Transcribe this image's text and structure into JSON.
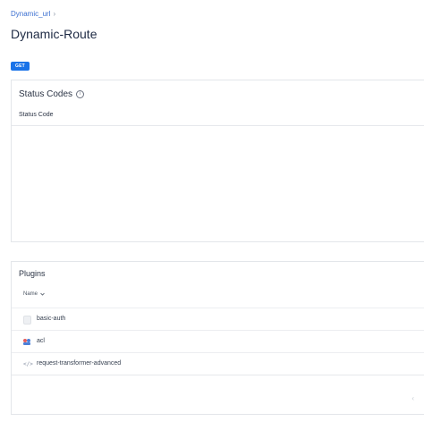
{
  "breadcrumb": {
    "parent": "Dynamic_url",
    "separator": "›"
  },
  "page": {
    "title": "Dynamic-Route",
    "method": "GET"
  },
  "status_codes": {
    "title": "Status Codes",
    "info_icon": "info-icon",
    "column_header": "Status Code"
  },
  "plugins": {
    "title": "Plugins",
    "name_header": "Name",
    "sort_icon": "chevron-down-icon",
    "items": [
      {
        "label": "basic-auth",
        "icon": "document-icon"
      },
      {
        "label": "acl",
        "icon": "users-icon"
      },
      {
        "label": "request-transformer-advanced",
        "icon": "code-icon"
      }
    ],
    "pagination_prev": "‹"
  },
  "colors": {
    "accent": "#1a73e8",
    "link": "#3b6fd1",
    "border": "#e3e6ea"
  }
}
